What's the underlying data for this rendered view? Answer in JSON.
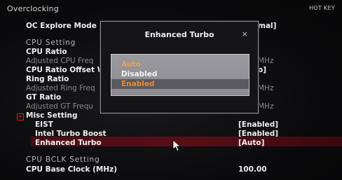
{
  "header": {
    "title": "Overclocking",
    "hotkey": "HOT KEY"
  },
  "rows": {
    "oc_explore": {
      "label": "OC Explore Mode",
      "value_fragment": "mal]"
    },
    "cpu_setting": "CPU Setting",
    "cpu_ratio": "CPU Ratio",
    "adj_cpu_freq": {
      "label": "Adjusted CPU Freq",
      "value_fragment": "MHz"
    },
    "cpu_ratio_offset": {
      "label": "CPU Ratio Offset W",
      "value_fragment": "o]"
    },
    "ring_ratio": "Ring Ratio",
    "adj_ring_freq": {
      "label": "Adjusted Ring Freq",
      "value_fragment": "MHz"
    },
    "gt_ratio": "GT Ratio",
    "adj_gt_freq": {
      "label": "Adjusted GT Frequ",
      "value_fragment": "MHz"
    },
    "misc_setting": "Misc Setting",
    "misc_toggle": "−",
    "eist": {
      "label": "EIST",
      "value": "[Enabled]"
    },
    "intel_turbo": {
      "label": "Intel Turbo Boost",
      "value": "[Enabled]"
    },
    "enhanced_turbo": {
      "label": "Enhanced Turbo",
      "value": "[Auto]"
    },
    "cpu_bclk": "CPU BCLK Setting",
    "cpu_base_clock": {
      "label": "CPU Base Clock (MHz)",
      "value": "100.00"
    }
  },
  "dialog": {
    "title": "Enhanced Turbo",
    "close": "×",
    "options": [
      "Auto",
      "Disabled",
      "Enabled"
    ],
    "selected": "Enabled"
  },
  "colors": {
    "selection_bar": "#5a0e16",
    "accent_orange": "#f08a2a",
    "collapse_red": "#e02424"
  }
}
